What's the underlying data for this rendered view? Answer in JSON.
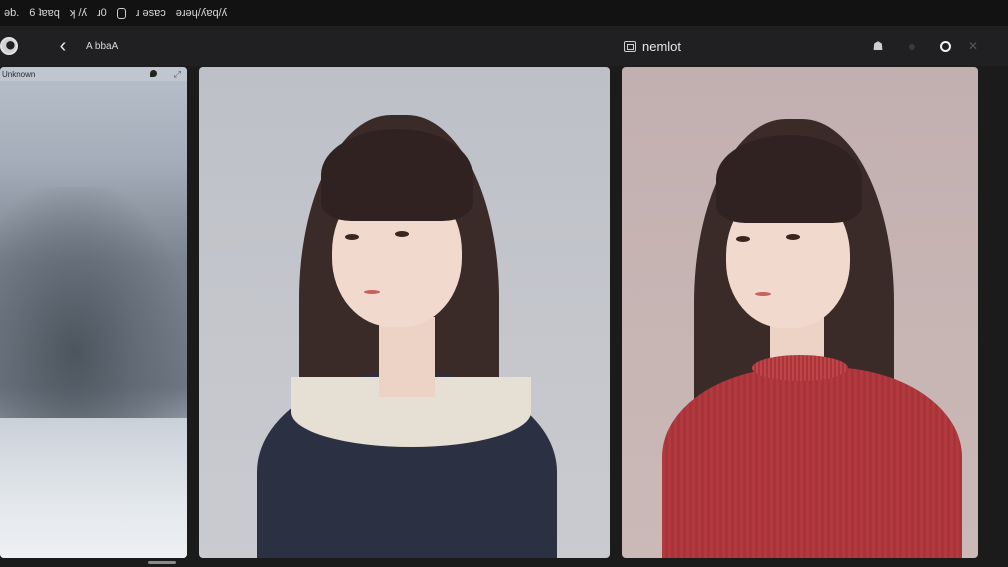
{
  "topbar": {
    "seg1": "ǝb.",
    "seg2": "6 ʇɐɐq",
    "seg3": "ʞ /ʎ",
    "seg4": "ɹ0",
    "seg5": "ɹ ǝsɐɔ",
    "seg6": "ǝɹǝɥ/ʎɐq/ʎ"
  },
  "toolbar": {
    "crumb": "A bbaA",
    "project_label": "nemlot"
  },
  "left_panel": {
    "header_text": "Unknown"
  },
  "icons": {
    "logo": "app-logo-icon",
    "back": "back-chevron-icon",
    "project": "image-frame-icon",
    "t1": "shape-icon",
    "t2": "circle-icon",
    "t3": "ring-icon",
    "t4": "close-icon"
  },
  "colors": {
    "background": "#1b1b1c",
    "toolbar": "#202022",
    "sweater": "#b23a3e",
    "dress": "#2b3142"
  }
}
